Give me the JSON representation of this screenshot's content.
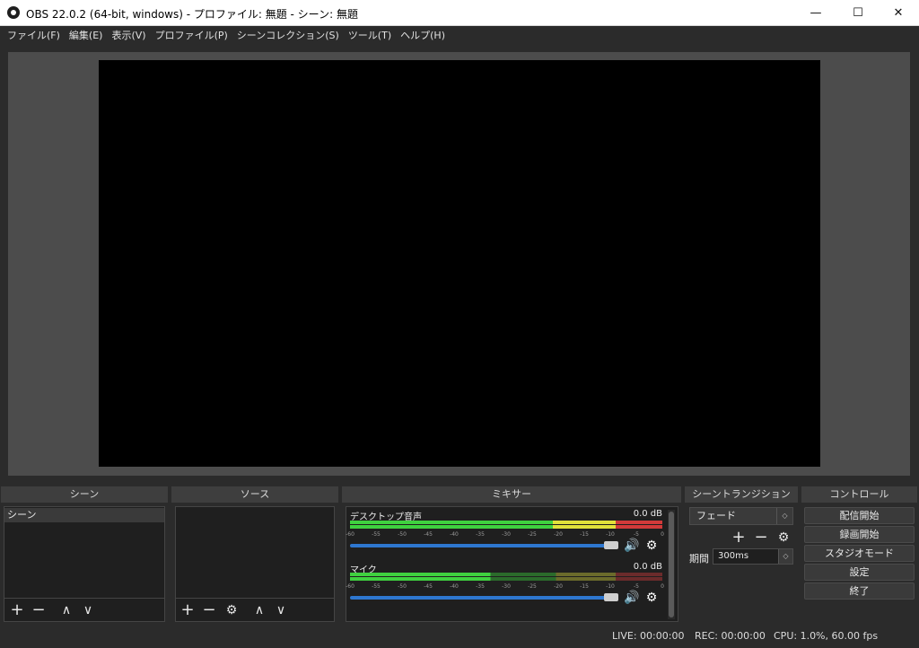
{
  "window": {
    "title": "OBS 22.0.2 (64-bit, windows) - プロファイル: 無題 - シーン: 無題",
    "minimize": "—",
    "maximize": "☐",
    "close": "✕"
  },
  "menu": [
    "ファイル(F)",
    "編集(E)",
    "表示(V)",
    "プロファイル(P)",
    "シーンコレクション(S)",
    "ツール(T)",
    "ヘルプ(H)"
  ],
  "docks": {
    "scenes_title": "シーン",
    "sources_title": "ソース",
    "mixer_title": "ミキサー",
    "transitions_title": "シーントランジション",
    "controls_title": "コントロール"
  },
  "scenes": {
    "items": [
      "シーン"
    ]
  },
  "mixer": {
    "channels": [
      {
        "name": "デスクトップ音声",
        "db": "0.0 dB",
        "volume": 1.0
      },
      {
        "name": "マイク",
        "db": "0.0 dB",
        "volume": 1.0
      }
    ],
    "scale": [
      "-60",
      "-55",
      "-50",
      "-45",
      "-40",
      "-35",
      "-30",
      "-25",
      "-20",
      "-15",
      "-10",
      "-5",
      "0"
    ]
  },
  "transitions": {
    "selected": "フェード",
    "duration_label": "期間",
    "duration_value": "300ms"
  },
  "controls": {
    "start_streaming": "配信開始",
    "start_recording": "録画開始",
    "studio_mode": "スタジオモード",
    "settings": "設定",
    "exit": "終了"
  },
  "status": {
    "live": "LIVE: 00:00:00",
    "rec": "REC: 00:00:00",
    "cpu": "CPU: 1.0%, 60.00 fps"
  },
  "icons": {
    "add": "+",
    "remove": "−",
    "up": "∧",
    "down": "∨",
    "gear": "⚙",
    "speaker": "🔊"
  },
  "colors": {
    "meter_green": "#3fd13f",
    "meter_yellow": "#e0e03a",
    "meter_red": "#d23a3a",
    "fader_blue": "#2e77d0"
  }
}
